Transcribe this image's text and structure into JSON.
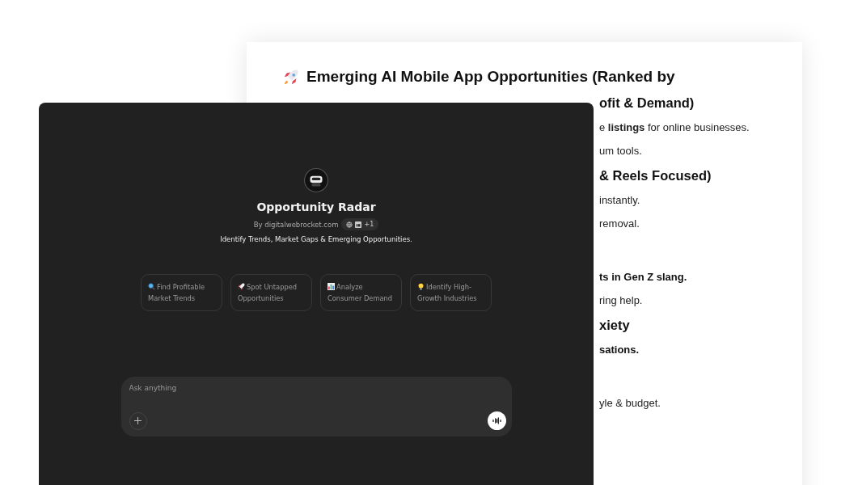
{
  "document": {
    "title": "Emerging AI Mobile App Opportunities (Ranked by",
    "fragments": [
      {
        "kind": "heading",
        "text": "ofit & Demand)"
      },
      {
        "kind": "text",
        "text": "e **listings** for online businesses."
      },
      {
        "kind": "text",
        "text": "um tools."
      },
      {
        "kind": "heading",
        "text": "& Reels Focused)"
      },
      {
        "kind": "text",
        "text": "instantly."
      },
      {
        "kind": "text",
        "text": "removal."
      },
      {
        "kind": "strong",
        "text": "ts in Gen Z slang."
      },
      {
        "kind": "text",
        "text": "ring help."
      },
      {
        "kind": "heading",
        "text": "xiety"
      },
      {
        "kind": "strong",
        "text": "sations."
      },
      {
        "kind": "text",
        "text": "yle & budget."
      }
    ]
  },
  "assistant": {
    "name": "Opportunity Radar",
    "author": "By digitalwebrocket.com",
    "links_more": "+1",
    "tagline": "Identify Trends, Market Gaps & Emerging Opportunities.",
    "suggestions": [
      {
        "kind": "search",
        "text": "Find Profitable Market Trends"
      },
      {
        "kind": "rocket",
        "text": "Spot Untapped Opportunities"
      },
      {
        "kind": "chart",
        "text": "Analyze Consumer Demand"
      },
      {
        "kind": "bulb",
        "text": "Identify High-Growth Industries"
      }
    ],
    "composer": {
      "placeholder": "Ask anything"
    }
  }
}
